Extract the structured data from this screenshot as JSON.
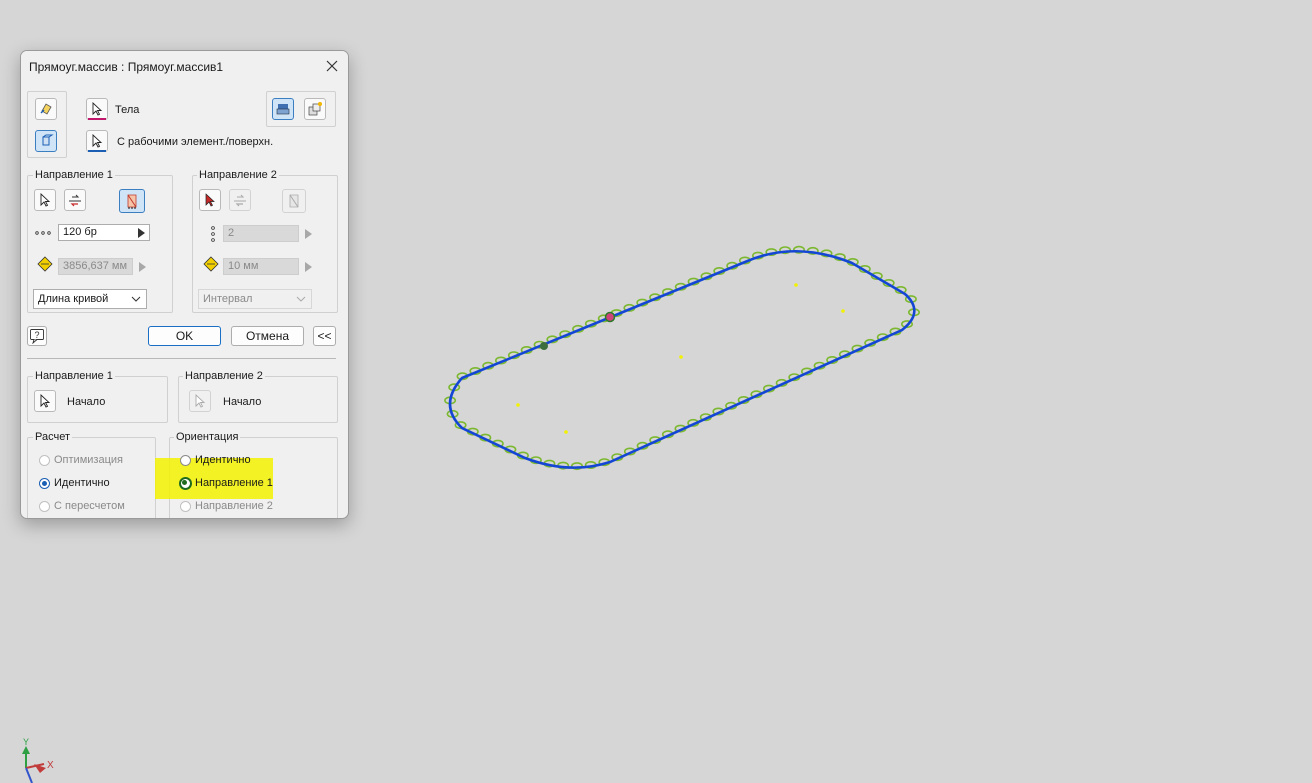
{
  "dialog": {
    "title": "Прямоуг.массив : Прямоуг.массив1",
    "top": {
      "bodies_label": "Тела",
      "work_features_label": "С рабочими элемент./поверхн."
    },
    "direction1": {
      "legend": "Направление 1",
      "count": "120 бр",
      "length": "3856,637 мм",
      "spacing_mode": "Длина кривой"
    },
    "direction2": {
      "legend": "Направление 2",
      "count": "2",
      "length": "10 мм",
      "spacing_mode": "Интервал"
    },
    "buttons": {
      "help": "?",
      "ok": "OK",
      "cancel": "Отмена",
      "collapse": "<<"
    },
    "start1": {
      "legend": "Направление 1",
      "start_label": "Начало"
    },
    "start2": {
      "legend": "Направление 2",
      "start_label": "Начало"
    },
    "compute": {
      "legend": "Расчет",
      "options": [
        "Оптимизация",
        "Идентично",
        "С пересчетом"
      ],
      "selected": "Идентично"
    },
    "orientation": {
      "legend": "Ориентация",
      "options": [
        "Идентично",
        "Направление 1",
        "Направление 2"
      ],
      "selected": "Направление 1"
    }
  },
  "triad": {
    "x_label": "X",
    "y_label": "Y"
  },
  "colors": {
    "path": "#1446d6",
    "instances": "#7cb82f",
    "highlight": "#f2f200",
    "accent": "#1a6fc4"
  }
}
